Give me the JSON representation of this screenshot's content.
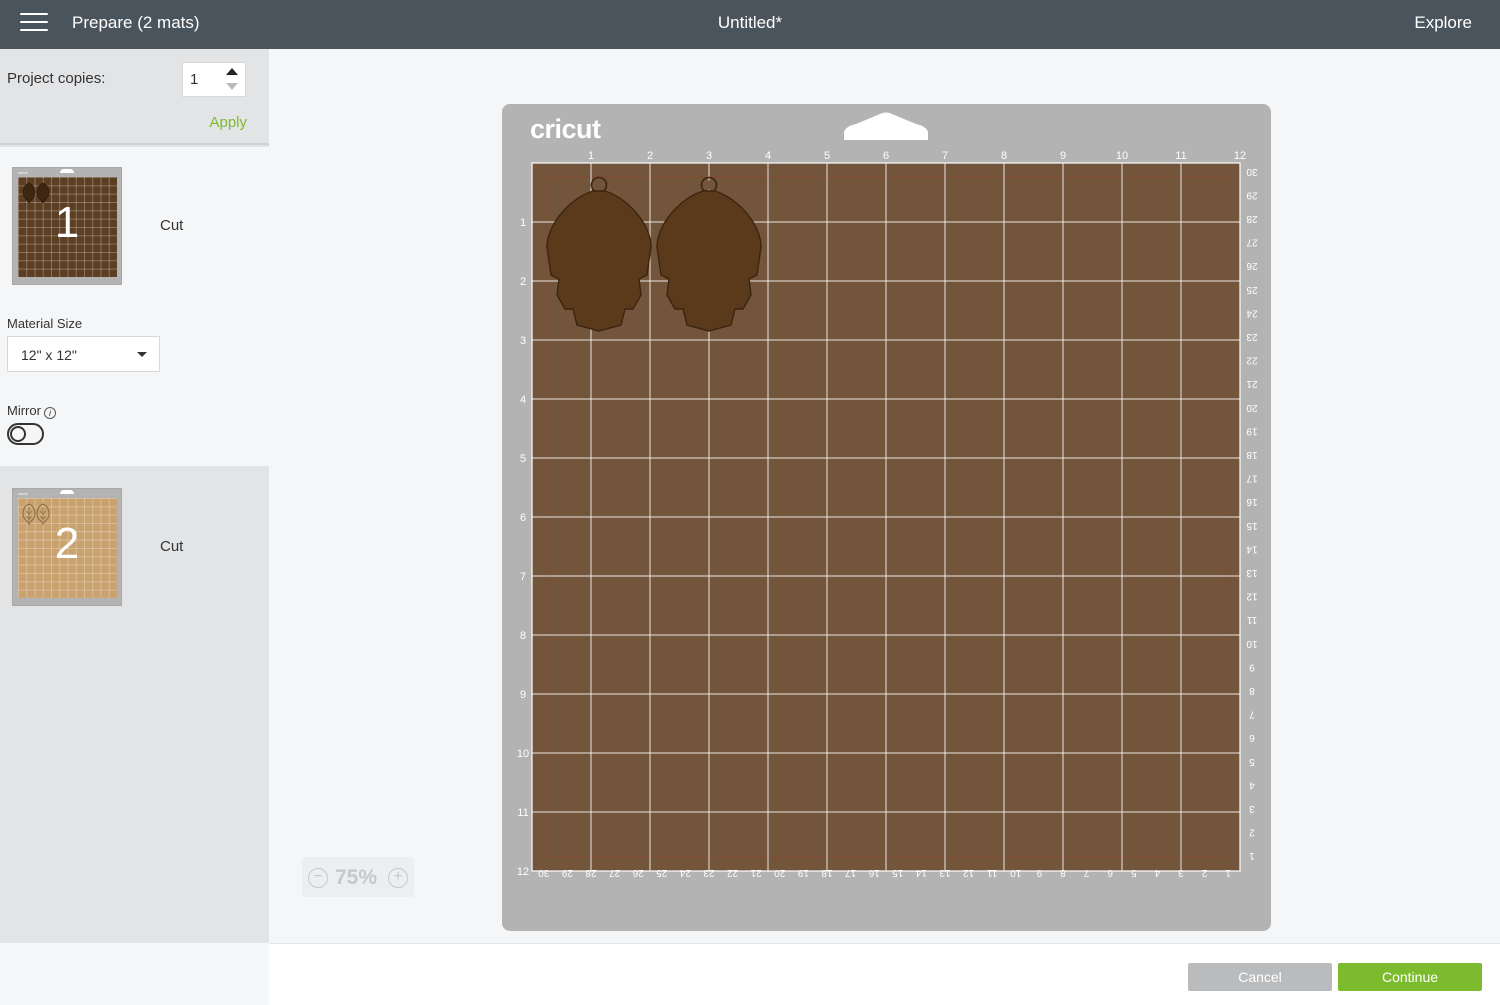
{
  "topbar": {
    "prepare_label": "Prepare (2 mats)",
    "doc_title": "Untitled*",
    "explore_label": "Explore"
  },
  "sidebar": {
    "copies_label": "Project copies:",
    "copies_value": "1",
    "apply_label": "Apply",
    "mats": [
      {
        "number": "1",
        "action": "Cut",
        "color": "#5c3e22"
      },
      {
        "number": "2",
        "action": "Cut",
        "color": "#c9a26f"
      }
    ],
    "material_size_label": "Material Size",
    "material_size_value": "12\" x 12\"",
    "mirror_label": "Mirror"
  },
  "canvas": {
    "mat_logo": "cricut",
    "mat_color": "#72553a",
    "top_ruler": [
      "1",
      "2",
      "3",
      "4",
      "5",
      "6",
      "7",
      "8",
      "9",
      "10",
      "11",
      "12"
    ],
    "left_ruler": [
      "1",
      "2",
      "3",
      "4",
      "5",
      "6",
      "7",
      "8",
      "9",
      "10",
      "11",
      "12"
    ],
    "right_ruler": [
      "30",
      "29",
      "28",
      "27",
      "26",
      "25",
      "24",
      "23",
      "22",
      "21",
      "20",
      "19",
      "18",
      "17",
      "16",
      "15",
      "14",
      "13",
      "12",
      "11",
      "10",
      "9",
      "8",
      "7",
      "6",
      "5",
      "4",
      "3",
      "2",
      "1"
    ],
    "bottom_ruler": [
      "30",
      "29",
      "28",
      "27",
      "26",
      "25",
      "24",
      "23",
      "22",
      "21",
      "20",
      "19",
      "18",
      "17",
      "16",
      "15",
      "14",
      "13",
      "12",
      "11",
      "10",
      "9",
      "8",
      "7",
      "6",
      "5",
      "4",
      "3",
      "2",
      "1"
    ],
    "zoom_value": "75%",
    "zoom_minus": "−",
    "zoom_plus": "+"
  },
  "footer": {
    "cancel_label": "Cancel",
    "continue_label": "Continue"
  }
}
